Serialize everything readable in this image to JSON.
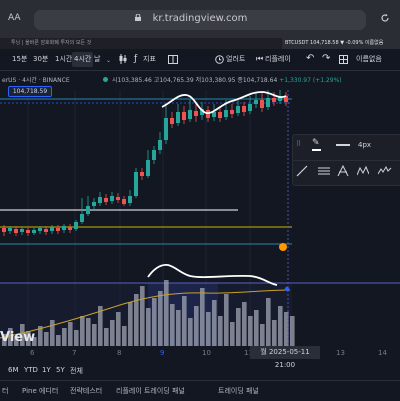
{
  "browser": {
    "aa_label": "AA",
    "url": "kr.tradingview.com"
  },
  "tabs": [
    {
      "label": "투닝 | 올바른 암호화폐 투자의 모든 것"
    },
    {
      "label": "BTCUSDT 104,718.58 ▼ -0.09% 이름없음"
    }
  ],
  "toolbar": {
    "items": [
      "15분",
      "30분",
      "1시간",
      "4시간",
      "날",
      "지표",
      "얼러트",
      "리플레이",
      "이름없음"
    ],
    "selected": "4시간"
  },
  "legend": {
    "symbol": "erUS · 4시간 · BINANCE",
    "open": "시103,385.46",
    "high": "고104,765.39",
    "low": "저103,380.95",
    "close": "종104,718.64",
    "change": "+1,330.97 (+1.29%)"
  },
  "price_tag": "104,718.59",
  "drawing_toolbar": {
    "width_label": "4px"
  },
  "watermark": "View",
  "time_axis": {
    "ticks": [
      "6",
      "7",
      "8",
      "9",
      "10",
      "11",
      "13",
      "14"
    ],
    "highlight": "9",
    "crosshair_date": "월 2025-05-11",
    "crosshair_time": "21:00"
  },
  "range_buttons": [
    "6M",
    "YTD",
    "1Y",
    "5Y",
    "전체"
  ],
  "bottom_tabs": [
    "터",
    "Pine 에디터",
    "전략테스터",
    "리플레이 트레이딩 패널",
    "트레이딩 패널"
  ],
  "colors": {
    "up": "#26a69a",
    "down": "#ef5350",
    "accent": "#2962ff"
  }
}
